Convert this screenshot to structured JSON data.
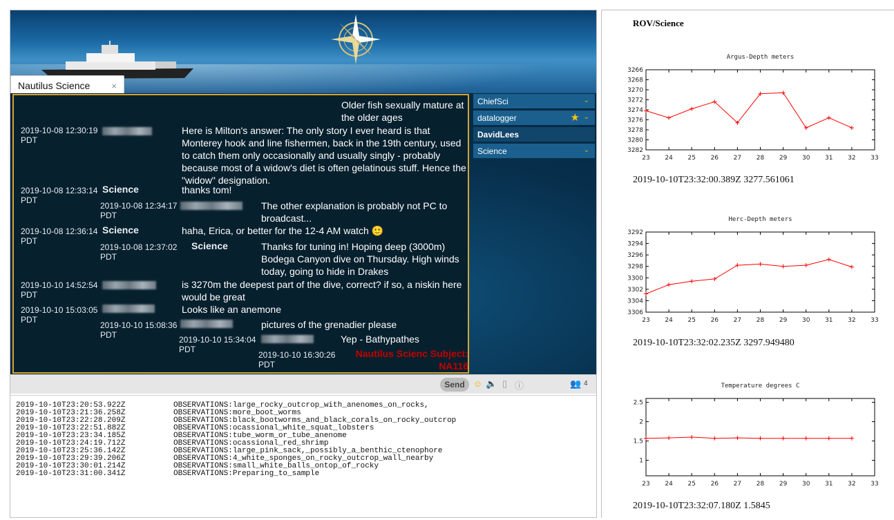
{
  "tab": {
    "label": "Nautilus Science",
    "close": "×"
  },
  "chat": {
    "messages": [
      {
        "text": "Older fish sexually mature at the older ages"
      },
      {
        "time": "2019-10-08 12:30:1\u0001",
        "tz": "PDT",
        "text": "Here is Milton's answer: The only story I ever heard is that Monterey hook and line fishermen, back in the 19th century, used to catch them only occasionally and usually singly - probably because most of a widow's diet is often gelatinous stuff. Hence the \"widow\" designation."
      },
      {
        "time": "2019-10-08 12:33:14",
        "tz": "PDT",
        "name": "Science",
        "text": "thanks tom!"
      },
      {
        "time": "2019-10-08 12:34:17",
        "tz": "PDT",
        "text": "The other explanation is probably not PC to broadcast..."
      },
      {
        "time": "2019-10-08 12:36:14",
        "tz": "PDT",
        "name": "Science",
        "text": "haha, Erica, or better for the 12-4 AM watch 🙂"
      },
      {
        "time": "2019-10-08 12:37:02",
        "tz": "PDT",
        "name": "Science",
        "text": "Thanks for tuning in! Hoping deep (3000m) Bodega Canyon dive on Thursday. High winds today, going to hide in Drakes"
      },
      {
        "time": "2019-10-10 14:52:54",
        "tz": "PDT",
        "text": "is 3270m the deepest part of the dive, correct? if so, a niskin here would be great"
      },
      {
        "time": "2019-10-10 15:03:05",
        "tz": "PDT",
        "text": "Looks like an anemone"
      },
      {
        "time": "2019-10-10 15:08:36",
        "tz": "PDT",
        "text": "pictures of the grenadier please"
      },
      {
        "time": "2019-10-10 15:34:04",
        "tz": "PDT",
        "text": "Yep - Bathypathes"
      },
      {
        "time": "2019-10-10 16:30:26",
        "tz": "PDT",
        "text": "Nautilus Scienc Subject: NA116"
      }
    ]
  },
  "roster": [
    {
      "label": "ChiefSci"
    },
    {
      "label": "datalogger"
    },
    {
      "label": "DavidLees"
    },
    {
      "label": "Science"
    }
  ],
  "input": {
    "send": "Send",
    "count": "4"
  },
  "log": [
    {
      "t": "2019-10-10T23:20:53.922Z",
      "v": "OBSERVATIONS:large_rocky_outcrop_with_anenomes_on_rocks,"
    },
    {
      "t": "2019-10-10T23:21:36.258Z",
      "v": "OBSERVATIONS:more_boot_worms"
    },
    {
      "t": "2019-10-10T23:22:28.209Z",
      "v": "OBSERVATIONS:black_bootworms_and_black_corals_on_rocky_outcrop"
    },
    {
      "t": "2019-10-10T23:22:51.882Z",
      "v": "OBSERVATIONS:ocassional_white_squat_lobsters"
    },
    {
      "t": "2019-10-10T23:23:34.185Z",
      "v": "OBSERVATIONS:tube_worm_or_tube_anenome"
    },
    {
      "t": "2019-10-10T23:24:19.712Z",
      "v": "OBSERVATIONS:ocassional_red_shrimp"
    },
    {
      "t": "2019-10-10T23:25:36.142Z",
      "v": "OBSERVATIONS:large_pink_sack,_possibly_a_benthic_ctenophore"
    },
    {
      "t": "2019-10-10T23:29:39.206Z",
      "v": "OBSERVATIONS:4_white_sponges_on_rocky_outcrop_wall_nearby"
    },
    {
      "t": "2019-10-10T23:30:01.214Z",
      "v": "OBSERVATIONS:small_white_balls_ontop_of_rocky"
    },
    {
      "t": "2019-10-10T23:31:00.341Z",
      "v": "OBSERVATIONS:Preparing_to_sample"
    }
  ],
  "right": {
    "title": "ROV/Science",
    "readings": [
      "2019-10-10T23:32:00.389Z 3277.561061",
      "2019-10-10T23:32:02.235Z 3297.949480",
      "2019-10-10T23:32:07.180Z 1.5845"
    ]
  },
  "colors": {
    "series": "#ff0000",
    "chatBorder": "#d3a531",
    "accentRed": "#c20000"
  },
  "chart_data": [
    {
      "type": "line",
      "title": "Argus-Depth meters",
      "inverted_y": true,
      "xlim": [
        23,
        33
      ],
      "xticks": [
        23,
        24,
        25,
        26,
        27,
        28,
        29,
        30,
        31,
        32,
        33
      ],
      "ylim": [
        3266,
        3282
      ],
      "yticks": [
        3266,
        3268,
        3270,
        3272,
        3274,
        3276,
        3278,
        3280,
        3282
      ],
      "x": [
        23.0,
        24.0,
        25.0,
        26.0,
        27.0,
        28.0,
        29.0,
        30.0,
        31.0,
        32.0
      ],
      "values": [
        3274.2,
        3275.6,
        3273.8,
        3272.4,
        3276.6,
        3270.8,
        3270.6,
        3277.6,
        3275.6,
        3277.6
      ]
    },
    {
      "type": "line",
      "title": "Herc-Depth meters",
      "inverted_y": true,
      "xlim": [
        23,
        33
      ],
      "xticks": [
        23,
        24,
        25,
        26,
        27,
        28,
        29,
        30,
        31,
        32,
        33
      ],
      "ylim": [
        3292,
        3306
      ],
      "yticks": [
        3292,
        3294,
        3296,
        3298,
        3300,
        3302,
        3304,
        3306
      ],
      "x": [
        23.0,
        24.0,
        25.0,
        26.0,
        27.0,
        28.0,
        29.0,
        30.0,
        31.0,
        32.0
      ],
      "values": [
        3302.8,
        3301.2,
        3300.6,
        3300.2,
        3297.8,
        3297.6,
        3298.0,
        3297.8,
        3296.8,
        3298.1
      ]
    },
    {
      "type": "line",
      "title": "Temperature degrees C",
      "inverted_y": false,
      "xlim": [
        23,
        33
      ],
      "xticks": [
        23,
        24,
        25,
        26,
        27,
        28,
        29,
        30,
        31,
        32,
        33
      ],
      "ylim": [
        0.6,
        2.6
      ],
      "yticks": [
        1,
        1.5,
        2,
        2.5
      ],
      "x": [
        23.0,
        24.0,
        25.0,
        26.0,
        27.0,
        28.0,
        29.0,
        30.0,
        31.0,
        32.0
      ],
      "values": [
        1.57,
        1.58,
        1.6,
        1.57,
        1.58,
        1.57,
        1.57,
        1.57,
        1.57,
        1.57
      ]
    }
  ]
}
